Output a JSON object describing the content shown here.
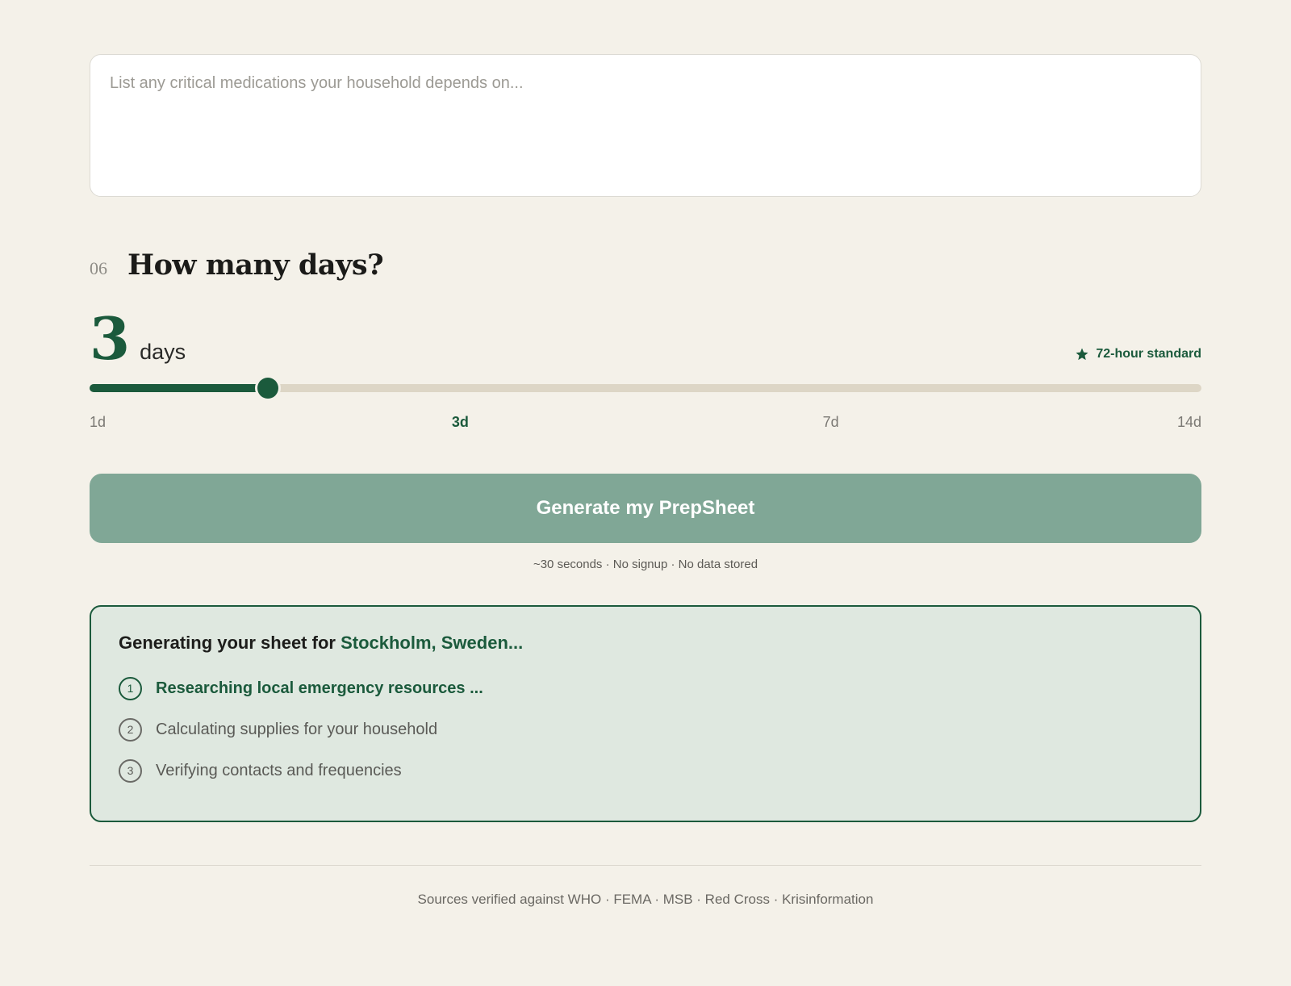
{
  "medications": {
    "value": "",
    "placeholder": "List any critical medications your household depends on..."
  },
  "days_section": {
    "step_number": "06",
    "title": "How many days?",
    "selected_days": "3",
    "unit": "days",
    "standard_label": "72-hour standard",
    "slider": {
      "min": 1,
      "max": 14,
      "value": 3
    },
    "ticks": [
      {
        "label": "1d",
        "value": 1
      },
      {
        "label": "3d",
        "value": 3
      },
      {
        "label": "7d",
        "value": 7
      },
      {
        "label": "14d",
        "value": 14
      }
    ]
  },
  "generate": {
    "button_label": "Generate my PrepSheet",
    "subnote": "~30 seconds · No signup · No data stored"
  },
  "progress": {
    "title_prefix": "Generating your sheet for ",
    "location": "Stockholm, Sweden",
    "title_suffix": "...",
    "steps": [
      {
        "number": "1",
        "label": "Researching local emergency resources ...",
        "active": true
      },
      {
        "number": "2",
        "label": "Calculating supplies for your household",
        "active": false
      },
      {
        "number": "3",
        "label": "Verifying contacts and frequencies",
        "active": false
      }
    ]
  },
  "footer": {
    "sources": "Sources verified against WHO · FEMA · MSB · Red Cross · Krisinformation"
  },
  "colors": {
    "accent": "#1b5a3c",
    "button": "#80a796",
    "background": "#f4f1e9",
    "panel": "#dfe8e0"
  }
}
